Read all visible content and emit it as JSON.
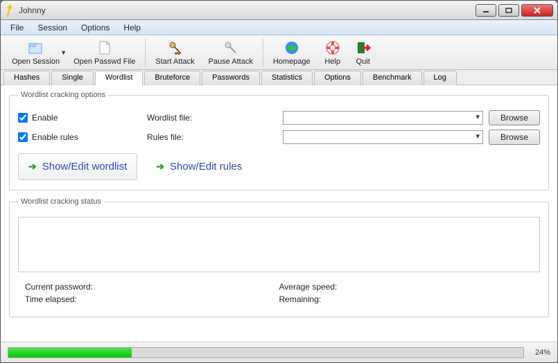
{
  "window": {
    "title": "Johnny"
  },
  "menubar": [
    "File",
    "Session",
    "Options",
    "Help"
  ],
  "toolbar": [
    {
      "id": "open-session",
      "label": "Open Session",
      "dropdown": true
    },
    {
      "id": "open-passwd",
      "label": "Open Passwd File"
    },
    {
      "sep": true
    },
    {
      "id": "start-attack",
      "label": "Start Attack"
    },
    {
      "id": "pause-attack",
      "label": "Pause Attack"
    },
    {
      "sep": true
    },
    {
      "id": "homepage",
      "label": "Homepage"
    },
    {
      "id": "help",
      "label": "Help"
    },
    {
      "id": "quit",
      "label": "Quit"
    }
  ],
  "tabs": {
    "items": [
      "Hashes",
      "Single",
      "Wordlist",
      "Bruteforce",
      "Passwords",
      "Statistics",
      "Options",
      "Benchmark",
      "Log"
    ],
    "active": "Wordlist"
  },
  "wordlist": {
    "group_title": "Wordlist cracking options",
    "enable_label": "Enable",
    "enable_checked": true,
    "enable_rules_label": "Enable rules",
    "enable_rules_checked": true,
    "wordlist_file_label": "Wordlist file:",
    "wordlist_file_value": "",
    "rules_file_label": "Rules file:",
    "rules_file_value": "",
    "browse_label": "Browse",
    "show_edit_wordlist": "Show/Edit wordlist",
    "show_edit_rules": "Show/Edit rules",
    "status_title": "Wordlist cracking status",
    "current_password_label": "Current password:",
    "current_password_value": "",
    "time_elapsed_label": "Time elapsed:",
    "time_elapsed_value": "",
    "avg_speed_label": "Average speed:",
    "avg_speed_value": "",
    "remaining_label": "Remaining:",
    "remaining_value": ""
  },
  "progress": {
    "percent": 24,
    "text": "24%"
  }
}
